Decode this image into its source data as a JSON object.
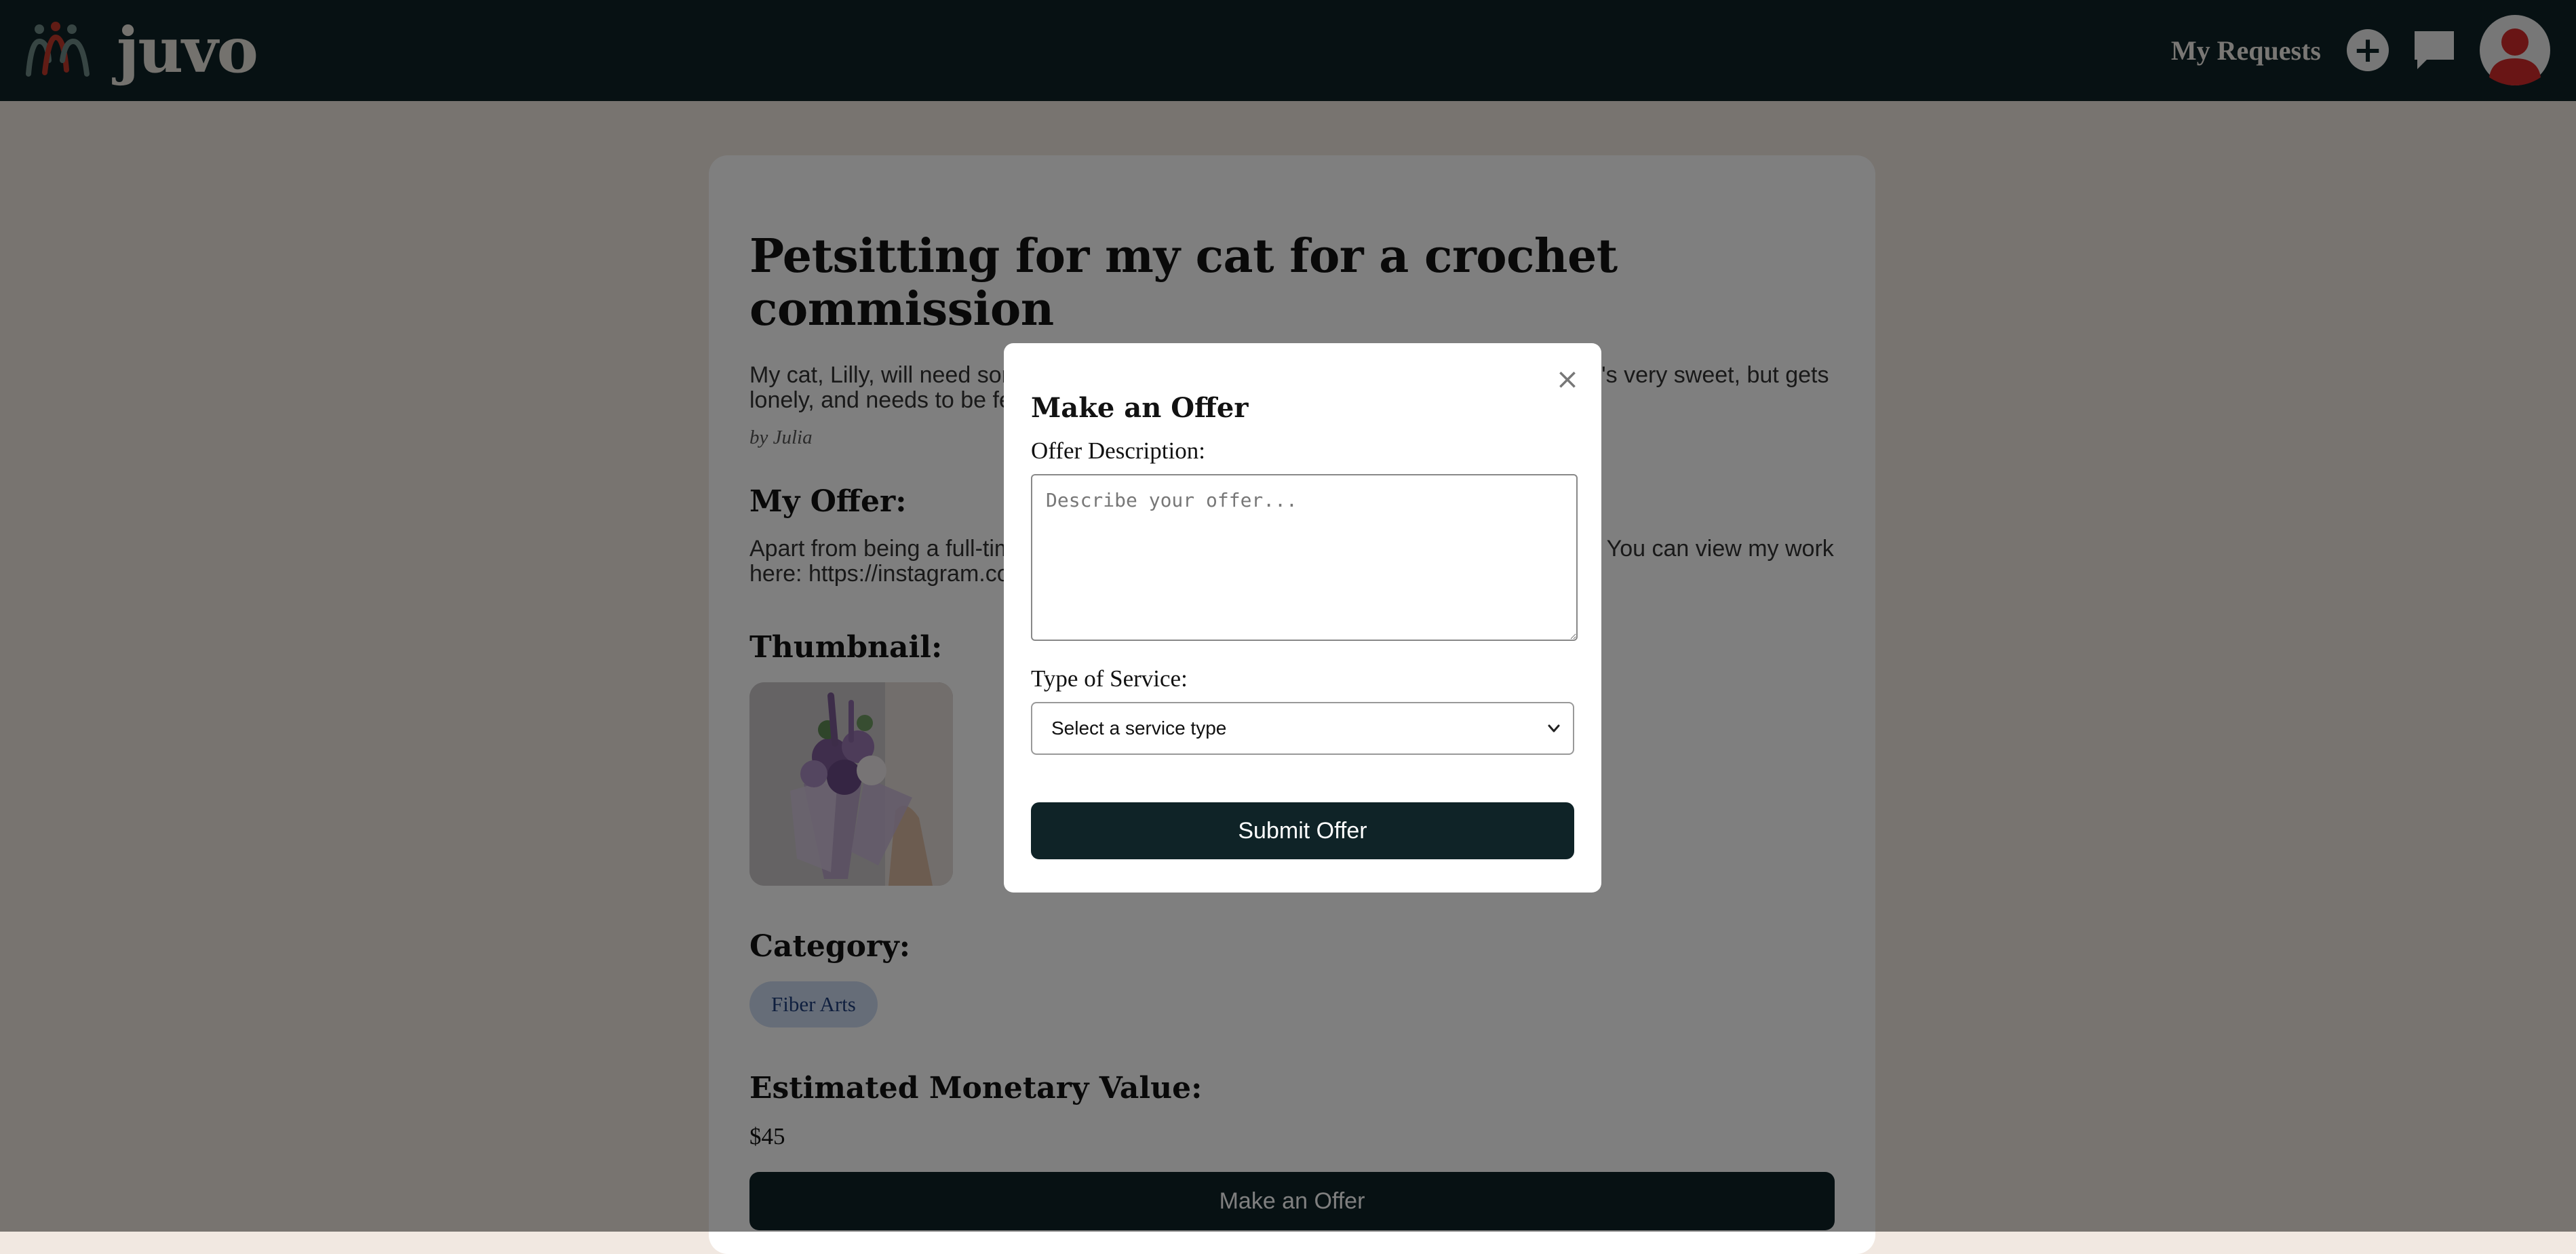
{
  "nav": {
    "logo_text": "juvo",
    "my_requests_label": "My Requests",
    "plus_icon": "+",
    "bg_color": "#0e2226"
  },
  "request": {
    "title": "Petsitting for my cat for a crochet commission",
    "description": "My cat, Lilly, will need some care while I'm away for the weekend to visit family. She's very sweet, but gets lonely, and needs to be fed a certain diet.",
    "byline": "by Julia",
    "my_offer_heading": "My Offer:",
    "my_offer_text": "Apart from being a full-time student, I also run a small crochet business on the side. You can view my work here: https://instagram.com/",
    "thumbnail_heading": "Thumbnail:",
    "category_heading": "Category:",
    "category": "Fiber Arts",
    "value_heading": "Estimated Monetary Value:",
    "value": "$45",
    "make_offer_label": "Make an Offer"
  },
  "modal": {
    "title": "Make an Offer",
    "close_glyph": "×",
    "description_label": "Offer Description:",
    "description_placeholder": "Describe your offer...",
    "service_label": "Type of Service:",
    "service_selected": "Select a service type",
    "submit_label": "Submit Offer"
  }
}
